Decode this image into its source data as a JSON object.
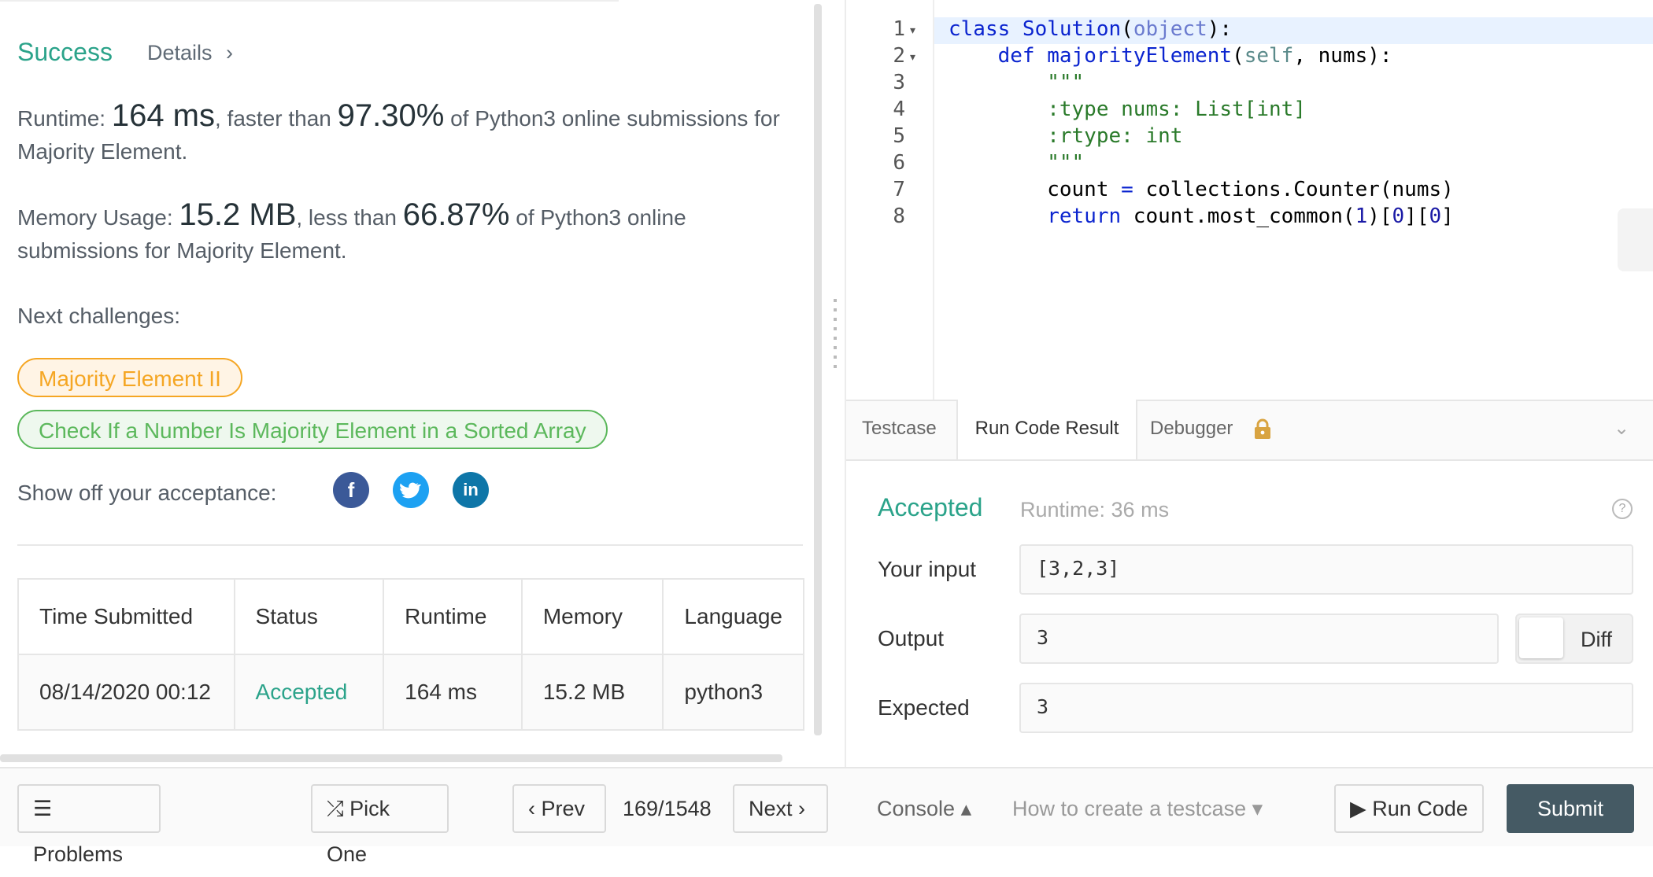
{
  "result": {
    "title": "Success",
    "details_label": "Details",
    "details_chevron": "›",
    "runtime_label": "Runtime:",
    "runtime_value": "164 ms",
    "runtime_mid": ", faster than",
    "runtime_pct": "97.30%",
    "runtime_tail": "of Python3 online submissions for Majority Element.",
    "memory_label": "Memory Usage:",
    "memory_value": "15.2 MB",
    "memory_mid": ", less than",
    "memory_pct": "66.87%",
    "memory_tail": "of Python3 online submissions for Majority Element.",
    "next_challenges_label": "Next challenges:",
    "challenges": [
      "Majority Element II",
      "Check If a Number Is Majority Element in a Sorted Array"
    ],
    "showoff_label": "Show off your acceptance:",
    "social": {
      "facebook": "f",
      "twitter": "t",
      "linkedin": "in"
    }
  },
  "submissions": {
    "headers": [
      "Time Submitted",
      "Status",
      "Runtime",
      "Memory",
      "Language"
    ],
    "rows": [
      [
        "08/14/2020 00:12",
        "Accepted",
        "164 ms",
        "15.2 MB",
        "python3"
      ]
    ]
  },
  "editor": {
    "line_numbers": [
      "1",
      "2",
      "3",
      "4",
      "5",
      "6",
      "7",
      "8"
    ],
    "fold_marker": "▾",
    "lines": [
      {
        "a": "class ",
        "b": "Solution",
        "c": "(",
        "d": "object",
        "e": "):"
      },
      {
        "a": "    def ",
        "b": "majorityElement",
        "c": "(",
        "d": "self",
        "e": ", nums):"
      },
      {
        "s": "        \"\"\""
      },
      {
        "s": "        :type nums: List[int]"
      },
      {
        "s": "        :rtype: int"
      },
      {
        "s": "        \"\"\""
      },
      {
        "p1": "        count ",
        "p2": "=",
        "p3": " collections.Counter(nums)"
      },
      {
        "p1": "        ",
        "p2": "return",
        "p3": " count.most_common(",
        "n1": "1",
        "p4": ")[",
        "n2": "0",
        "p5": "][",
        "n3": "0",
        "p6": "]"
      }
    ]
  },
  "tabs": [
    "Testcase",
    "Run Code Result",
    "Debugger"
  ],
  "tab_chevron": "⌄",
  "run_result": {
    "status": "Accepted",
    "runtime": "Runtime: 36 ms",
    "help": "?",
    "input_label": "Your input",
    "input_value": "[3,2,3]",
    "output_label": "Output",
    "output_value": "3",
    "diff_label": "Diff",
    "expected_label": "Expected",
    "expected_value": "3"
  },
  "bottom": {
    "problems": "☰ Problems",
    "pick_one": "⤮ Pick One",
    "prev": "‹  Prev",
    "page": "169/1548",
    "next": "Next  ›",
    "console": "Console ▴",
    "howto": "How to create a testcase ▾",
    "run_code": "▶ Run Code",
    "submit": "Submit"
  },
  "colors": {
    "accent": "#2ba38a",
    "submit_bg": "#455a64",
    "orange": "#f5a623",
    "green": "#5cb85c"
  }
}
